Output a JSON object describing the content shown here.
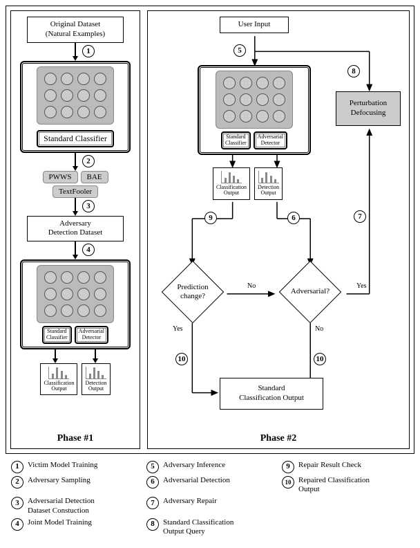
{
  "phase1": {
    "label": "Phase #1",
    "original": "Original Dataset\n(Natural Examples)",
    "stdClassifier": "Standard Classifier",
    "attacks": {
      "pwws": "PWWS",
      "bae": "BAE",
      "tf": "TextFooler"
    },
    "advDataset": "Adversary\nDetection Dataset",
    "subStd": "Standard\nClassifier",
    "subAdv": "Adversarial\nDetector",
    "clsOut": "Classification\nOutput",
    "detOut": "Detection\nOutput"
  },
  "phase2": {
    "label": "Phase #2",
    "userInput": "User Input",
    "subStd": "Standard\nClassifier",
    "subAdv": "Adversarial\nDetector",
    "clsOut": "Classification\nOutput",
    "detOut": "Detection\nOutput",
    "pd": "Perturbation\nDefocusing",
    "predChange": "Prediction\nchange?",
    "adversarial": "Adversarial?",
    "stdClsOut": "Standard\nClassification Output",
    "no": "No",
    "yes": "Yes"
  },
  "legend": {
    "1": "Victim Model Training",
    "2": "Adversary Sampling",
    "3": "Adversarial Detection\nDataset Constuction",
    "4": "Joint Model Training",
    "5": "Adversary Inference",
    "6": "Adversarial Detection",
    "7": "Adversary Repair",
    "8": "Standard Classification\nOutput Query",
    "9": "Repair Result Check",
    "10": "Repaired Classification\nOutput"
  }
}
